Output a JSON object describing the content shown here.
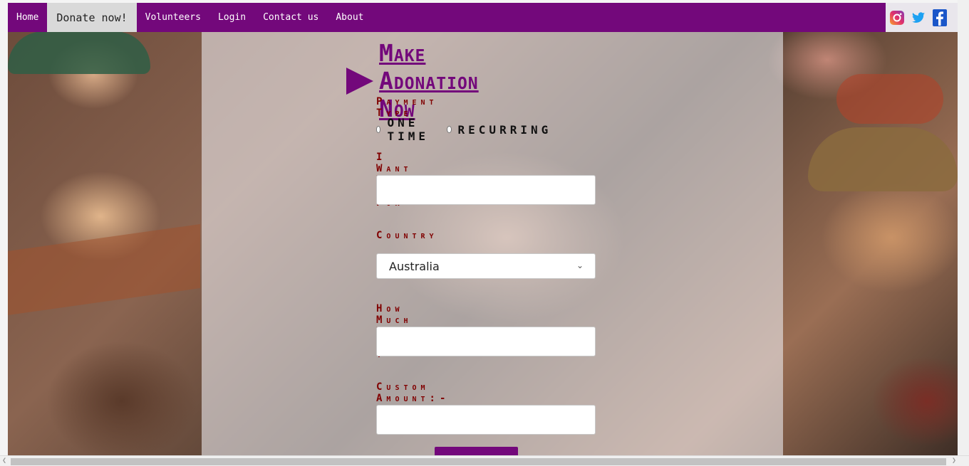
{
  "nav": {
    "items": [
      {
        "label": "Home",
        "active": false
      },
      {
        "label": "Donate now!",
        "active": true
      },
      {
        "label": "Volunteers",
        "active": false
      },
      {
        "label": "Login",
        "active": false
      },
      {
        "label": "Contact us",
        "active": false
      },
      {
        "label": "About",
        "active": false
      }
    ],
    "color": "#73087b"
  },
  "social": [
    "instagram-icon",
    "twitter-icon",
    "facebook-icon"
  ],
  "form": {
    "title": "Make Adonation Now",
    "payment_type_label": "Payment Type",
    "option_one_time": "ONE TIME",
    "option_recurring": "RECURRING",
    "donate_for_label": "I Want To Donate For",
    "donate_for_value": "",
    "country_label": "Country",
    "country_value": "Australia",
    "amount_label": "How Much To Donate ?",
    "amount_value": "",
    "custom_amount_label": "Custom Amount:-",
    "custom_amount_value": ""
  },
  "colors": {
    "accent": "#73087b",
    "label": "#800000"
  }
}
